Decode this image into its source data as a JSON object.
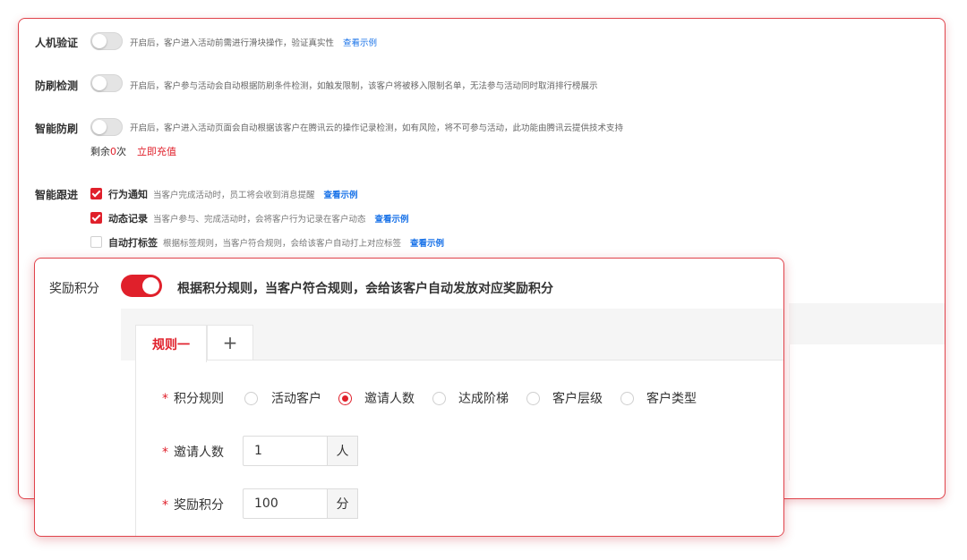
{
  "settings": {
    "captcha": {
      "label": "人机验证",
      "desc": "开启后，客户进入活动前需进行滑块操作，验证真实性",
      "link": "查看示例"
    },
    "anti_brush": {
      "label": "防刷检测",
      "desc": "开启后，客户参与活动会自动根据防刷条件检测，如触发限制，该客户将被移入限制名单，无法参与活动同时取消排行榜展示"
    },
    "smart_anti_brush": {
      "label": "智能防刷",
      "desc": "开启后，客户进入活动页面会自动根据该客户在腾讯云的操作记录检测，如有风险，将不可参与活动，此功能由腾讯云提供技术支持",
      "remain_prefix": "剩余",
      "remain_count": "0",
      "remain_unit": "次",
      "recharge": "立即充值"
    },
    "smart_follow": {
      "label": "智能跟进",
      "options": [
        {
          "label": "行为通知",
          "desc": "当客户完成活动时，员工将会收到消息提醒",
          "link": "查看示例",
          "checked": true
        },
        {
          "label": "动态记录",
          "desc": "当客户参与、完成活动时，会将客户行为记录在客户动态",
          "link": "查看示例",
          "checked": true
        },
        {
          "label": "自动打标签",
          "desc": "根据标签规则，当客户符合规则，会给该客户自动打上对应标签",
          "link": "查看示例",
          "checked": false
        }
      ]
    }
  },
  "reward": {
    "label": "奖励积分",
    "enabled": true,
    "desc": "根据积分规则，当客户符合规则，会给该客户自动发放对应奖励积分",
    "tabs": [
      "规则一",
      "+"
    ],
    "rule_label": "积分规则",
    "required_mark": "*",
    "rule_options": [
      "活动客户",
      "邀请人数",
      "达成阶梯",
      "客户层级",
      "客户类型"
    ],
    "rule_selected": "邀请人数",
    "invite_label": "邀请人数",
    "invite_value": "1",
    "invite_unit": "人",
    "points_label": "奖励积分",
    "points_value": "100",
    "points_unit": "分"
  },
  "colors": {
    "accent": "#e0202b",
    "link": "#1a73e8"
  }
}
